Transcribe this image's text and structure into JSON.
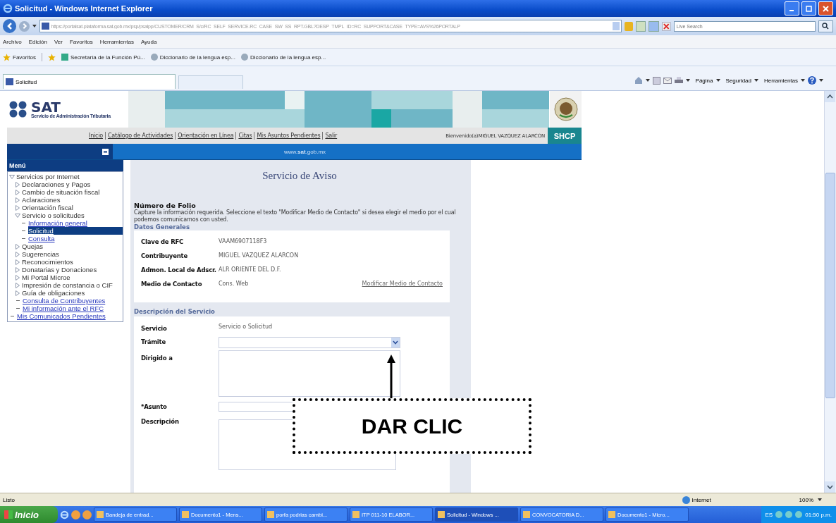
{
  "window": {
    "title": "Solicitud - Windows Internet Explorer"
  },
  "address_bar": {
    "url": "https://portalsat.plataforma.sat.gob.mx/psp/psalpp/CUSTOMER/CRM_S/c/RC_SELF_SERVICE.RC_CASE_SW_SS_RPT.GBL?DESP_TMPL_ID=RC_SUPPORT&CASE_TYPE=AVS%26PORTALP",
    "search_placeholder": "Live Search"
  },
  "menu_bar": [
    "Archivo",
    "Edición",
    "Ver",
    "Favoritos",
    "Herramientas",
    "Ayuda"
  ],
  "favorites_bar": {
    "label": "Favoritos",
    "links": [
      "Secretaría de la Función Pú...",
      "Diccionario de la lengua esp...",
      "Diccionario de la lengua esp..."
    ]
  },
  "tabs": [
    {
      "label": "Solicitud",
      "selected": true
    }
  ],
  "command_bar": [
    "Página",
    "Seguridad",
    "Herramientas"
  ],
  "site_header": {
    "logo_text": "SAT",
    "logo_subtitle": "Servicio de Administración Tributaria",
    "badge": "SHCP",
    "nav_links": [
      "Inicio",
      "Catálogo de Actividades",
      "Orientación en Línea",
      "Citas",
      "Mis Asuntos Pendientes",
      "Salir"
    ],
    "welcome": "Bienvenido(a)MIGUEL VAZQUEZ ALARCON",
    "domain": "www.**sat**.gob.mx"
  },
  "sidebar": {
    "title": "Menú",
    "items": [
      {
        "label": "Servicios por Internet",
        "kind": "folder",
        "expanded": true,
        "selected": false,
        "children": [
          {
            "label": "Declaraciones y Pagos",
            "kind": "folder",
            "expanded": false,
            "selected": false
          },
          {
            "label": "Cambio de situación fiscal",
            "kind": "folder",
            "expanded": false,
            "selected": false
          },
          {
            "label": "Aclaraciones",
            "kind": "folder",
            "expanded": false,
            "selected": false
          },
          {
            "label": "Orientación fiscal",
            "kind": "folder",
            "expanded": false,
            "selected": false
          },
          {
            "label": "Servicio o solicitudes",
            "kind": "folder",
            "expanded": true,
            "selected": false,
            "children": [
              {
                "label": "Información general",
                "kind": "link",
                "selected": false
              },
              {
                "label": "Solicitud",
                "kind": "link",
                "selected": true
              },
              {
                "label": "Consulta",
                "kind": "link",
                "selected": false
              }
            ]
          },
          {
            "label": "Quejas",
            "kind": "folder",
            "expanded": false,
            "selected": false
          },
          {
            "label": "Sugerencias",
            "kind": "folder",
            "expanded": false,
            "selected": false
          },
          {
            "label": "Reconocimientos",
            "kind": "folder",
            "expanded": false,
            "selected": false
          },
          {
            "label": "Donatarias y Donaciones",
            "kind": "folder",
            "expanded": false,
            "selected": false
          },
          {
            "label": "Mi Portal Microe",
            "kind": "folder",
            "expanded": false,
            "selected": false
          },
          {
            "label": "Impresión de constancia o CIF",
            "kind": "folder",
            "expanded": false,
            "selected": false
          },
          {
            "label": "Guía de obligaciones",
            "kind": "folder",
            "expanded": false,
            "selected": false
          },
          {
            "label": "Consulta de Contribuyentes",
            "kind": "link",
            "selected": false
          },
          {
            "label": "Mi información ante el RFC",
            "kind": "link",
            "selected": false
          }
        ]
      },
      {
        "label": "Mis Comunicados Pendientes",
        "kind": "link",
        "selected": false
      }
    ]
  },
  "form": {
    "title": "Servicio de Aviso",
    "folio_label": "Número de Folio",
    "instructions": "Capture la información requerida. Seleccione el texto \"Modificar Medio de Contacto\" si desea elegir el medio por el cual podemos comunicarnos con usted.",
    "general_heading": "Datos Generales",
    "general_rows": [
      {
        "label": "Clave de RFC",
        "value": "VAAM6907118F3"
      },
      {
        "label": "Contribuyente",
        "value": "MIGUEL VAZQUEZ ALARCON"
      },
      {
        "label": "Admon. Local de Adscr.",
        "value": "ALR ORIENTE DEL D.F."
      },
      {
        "label": "Medio de Contacto",
        "value": "Cons. Web",
        "link": "Modificar Medio de Contacto"
      }
    ],
    "service_heading": "Descripción del Servicio",
    "service_rows": [
      {
        "label": "Servicio",
        "kind": "text",
        "value": "Servicio o Solicitud"
      },
      {
        "label": "Trámite",
        "kind": "select"
      },
      {
        "label": "Dirigido a",
        "kind": "textarea"
      },
      {
        "label": "*Asunto",
        "kind": "input"
      },
      {
        "label": "Descripción",
        "kind": "textarea"
      }
    ]
  },
  "annotation": {
    "text": "DAR CLIC"
  },
  "status_bar": {
    "text": "Listo",
    "zone": "Internet",
    "zoom": "100%"
  },
  "taskbar": {
    "start": "Inicio",
    "items": [
      {
        "label": "Bandeja de entrad...",
        "selected": false
      },
      {
        "label": "Documento1 - Mens...",
        "selected": false
      },
      {
        "label": "porfa podrias cambi...",
        "selected": false
      },
      {
        "label": "ITP 011-10 ELABOR...",
        "selected": false
      },
      {
        "label": "Solicitud - Windows ...",
        "selected": true
      },
      {
        "label": "CONVOCATORIA D...",
        "selected": false
      },
      {
        "label": "Documento1 - Micro...",
        "selected": false
      }
    ],
    "language": "ES",
    "clock": "01:50 p.m."
  }
}
